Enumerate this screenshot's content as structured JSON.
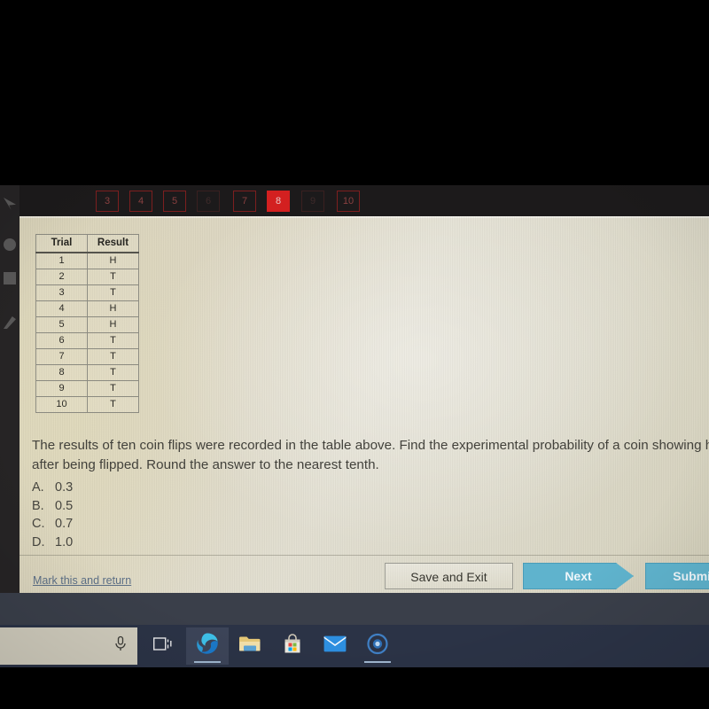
{
  "quiz": {
    "question_tabs": [
      {
        "number": "3",
        "state": "normal"
      },
      {
        "number": "4",
        "state": "normal"
      },
      {
        "number": "5",
        "state": "normal"
      },
      {
        "number": "6",
        "state": "faint"
      },
      {
        "number": "7",
        "state": "normal"
      },
      {
        "number": "8",
        "state": "current"
      },
      {
        "number": "9",
        "state": "faint"
      },
      {
        "number": "10",
        "state": "normal"
      }
    ],
    "table": {
      "headers": [
        "Trial",
        "Result"
      ],
      "rows": [
        [
          "1",
          "H"
        ],
        [
          "2",
          "T"
        ],
        [
          "3",
          "T"
        ],
        [
          "4",
          "H"
        ],
        [
          "5",
          "H"
        ],
        [
          "6",
          "T"
        ],
        [
          "7",
          "T"
        ],
        [
          "8",
          "T"
        ],
        [
          "9",
          "T"
        ],
        [
          "10",
          "T"
        ]
      ]
    },
    "question_line1": "The results of ten coin flips were recorded in the table above. Find the experimental probability of a coin showing heads",
    "question_line2": "after being flipped. Round the answer to the nearest tenth.",
    "choices": [
      {
        "label": "A.",
        "value": "0.3"
      },
      {
        "label": "B.",
        "value": "0.5"
      },
      {
        "label": "C.",
        "value": "0.7"
      },
      {
        "label": "D.",
        "value": "1.0"
      }
    ],
    "mark_link": "Mark this and return",
    "save_button": "Save and Exit",
    "next_button": "Next",
    "submit_button": "Submit"
  },
  "taskbar": {
    "items": [
      {
        "icon": "microphone-icon",
        "active": false
      },
      {
        "icon": "task-view-icon",
        "active": false
      },
      {
        "icon": "edge-browser-icon",
        "active": true
      },
      {
        "icon": "file-explorer-icon",
        "active": false
      },
      {
        "icon": "microsoft-store-icon",
        "active": false
      },
      {
        "icon": "mail-icon",
        "active": false
      },
      {
        "icon": "app-circle-icon",
        "active": false
      }
    ]
  },
  "colors": {
    "accent_teal": "#5fb3cd",
    "current_tab_red": "#d32020",
    "link_blue": "#5c6f86",
    "taskbar": "#2b3346"
  }
}
